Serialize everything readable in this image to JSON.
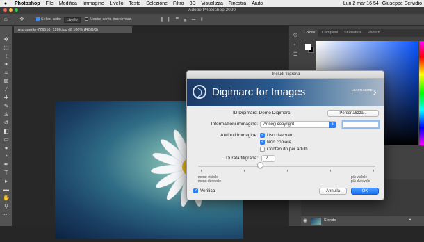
{
  "menubar": {
    "app_name": "Photoshop",
    "items": [
      "File",
      "Modifica",
      "Immagine",
      "Livello",
      "Testo",
      "Selezione",
      "Filtro",
      "3D",
      "Visualizza",
      "Finestra",
      "Aiuto"
    ],
    "clock": "Lun 2 mar 16 54",
    "user": "Giuseppe Servidio"
  },
  "window": {
    "title": "Adobe Photoshop 2020"
  },
  "options_bar": {
    "auto_select_label": "Selez. auto:",
    "auto_select_value": "Livello",
    "transform_controls_label": "Mostra contr. trasformaz."
  },
  "document": {
    "tab_title": "marguerite-729510_1280.jpg @ 100% (RGB/8)"
  },
  "panel": {
    "tabs": [
      "Colore",
      "Campioni",
      "Sfumature",
      "Pattern"
    ],
    "layer_name": "Sfondo"
  },
  "dialog": {
    "title": "Includi filigrana",
    "banner_brand": "Digimarc for Images",
    "banner_learn": "LEARN MORE",
    "digimarc_id_label": "ID Digimarc: Demo Digimarc",
    "personalize_button": "Personalizza...",
    "image_info_label": "Informazioni immagine:",
    "image_info_value": "Anno() copyright",
    "image_attrs_label": "Attributi immagine:",
    "attr_restricted": "Uso riservato",
    "attr_do_not_copy": "Non copiare",
    "attr_adult": "Contenuto per adulti",
    "durability_label": "Durata filigrana:",
    "durability_value": "2",
    "slider_left_line1": "meno visibile",
    "slider_left_line2": "meno durevole",
    "slider_right_line1": "più visibile",
    "slider_right_line2": "più durevole",
    "verify_label": "Verifica",
    "cancel_button": "Annulla",
    "ok_button": "OK",
    "slider_level": 0.35,
    "checkboxes": {
      "restricted": true,
      "do_not_copy": true,
      "adult": false,
      "verify": true
    }
  },
  "colors": {
    "accent": "#2a7ef5",
    "ps_dark": "#262626",
    "ps_panel": "#424242"
  },
  "icons": [
    "apple-icon",
    "home-icon",
    "move-tool-icon",
    "eye-icon",
    "lock-icon",
    "arrow-right-icon",
    "digimarc-logo-icon",
    "chevron-up-down-icon"
  ]
}
